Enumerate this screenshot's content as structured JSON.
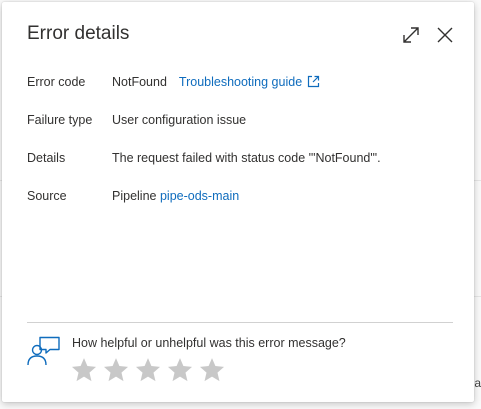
{
  "dialog": {
    "title": "Error details"
  },
  "rows": {
    "error_code": {
      "label": "Error code",
      "value": "NotFound",
      "link": "Troubleshooting guide"
    },
    "failure_type": {
      "label": "Failure type",
      "value": "User configuration issue"
    },
    "details": {
      "label": "Details",
      "value": "The request failed with status code '\"NotFound\"'."
    },
    "source": {
      "label": "Source",
      "prefix": "Pipeline",
      "link": "pipe-ods-main"
    }
  },
  "feedback": {
    "question": "How helpful or unhelpful was this error message?",
    "rating": 0,
    "max_rating": 5
  },
  "background": {
    "stray_char": "a"
  },
  "icons": {
    "expand": "expand-icon",
    "close": "close-icon",
    "external": "external-link-icon",
    "feedback": "feedback-person-chat-icon",
    "star": "star-icon"
  },
  "colors": {
    "link": "#0f6cbd",
    "text": "#323130",
    "star_empty": "#c8c8c8",
    "feedback_icon": "#0f6cbd"
  }
}
